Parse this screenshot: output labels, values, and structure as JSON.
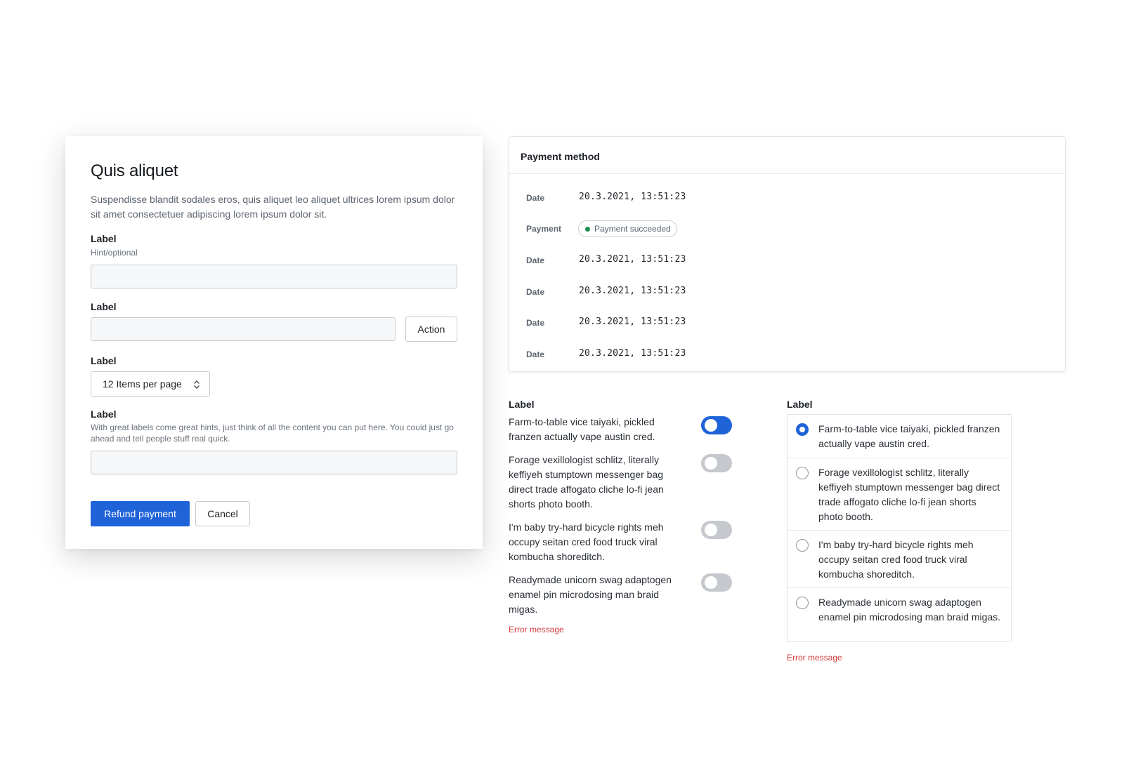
{
  "modal": {
    "title": "Quis aliquet",
    "description": "Suspendisse blandit sodales eros, quis aliquet leo aliquet ultrices lorem ipsum dolor sit amet consectetuer adipiscing lorem ipsum dolor sit.",
    "field1": {
      "label": "Label",
      "hint": "Hint/optional",
      "value": ""
    },
    "field2": {
      "label": "Label",
      "value": "",
      "action_label": "Action"
    },
    "field3": {
      "label": "Label",
      "selected": "12 Items per page"
    },
    "field4": {
      "label": "Label",
      "hint": "With great labels come great hints, just think of all the content you can put here. You could just go ahead and tell people stuff real quick.",
      "value": ""
    },
    "primary_label": "Refund payment",
    "cancel_label": "Cancel"
  },
  "payment": {
    "title": "Payment method",
    "rows": [
      {
        "key": "Date",
        "value": "20.3.2021, 13:51:23"
      },
      {
        "key": "Payment",
        "badge": "Payment succeeded"
      },
      {
        "key": "Date",
        "value": "20.3.2021, 13:51:23"
      },
      {
        "key": "Date",
        "value": "20.3.2021, 13:51:23"
      },
      {
        "key": "Date",
        "value": "20.3.2021, 13:51:23"
      },
      {
        "key": "Date",
        "value": "20.3.2021, 13:51:23"
      }
    ],
    "badge_color": "#1e8e4a"
  },
  "toggles": {
    "label": "Label",
    "items": [
      {
        "text": "Farm-to-table vice taiyaki, pickled franzen actually vape austin cred.",
        "on": true
      },
      {
        "text": "Forage vexillologist schlitz, literally keffiyeh stumptown messenger bag direct trade affogato cliche lo-fi jean shorts photo booth.",
        "on": false
      },
      {
        "text": "I'm baby try-hard bicycle rights meh occupy seitan cred food truck viral kombucha shoreditch.",
        "on": false
      },
      {
        "text": "Readymade unicorn swag adaptogen enamel pin microdosing man braid migas.",
        "on": false
      }
    ],
    "error": "Error message"
  },
  "radios": {
    "label": "Label",
    "items": [
      {
        "text": "Farm-to-table vice taiyaki, pickled franzen actually vape austin cred.",
        "selected": true
      },
      {
        "text": "Forage vexillologist schlitz, literally keffiyeh stumptown messenger bag direct trade affogato cliche lo-fi jean shorts photo booth.",
        "selected": false
      },
      {
        "text": "I'm baby try-hard bicycle rights meh occupy seitan cred food truck viral kombucha shoreditch.",
        "selected": false
      },
      {
        "text": "Readymade unicorn swag adaptogen enamel pin microdosing man braid migas.",
        "selected": false
      }
    ],
    "error": "Error message"
  },
  "colors": {
    "accent": "#1f63d9",
    "error": "#d03b3b"
  }
}
